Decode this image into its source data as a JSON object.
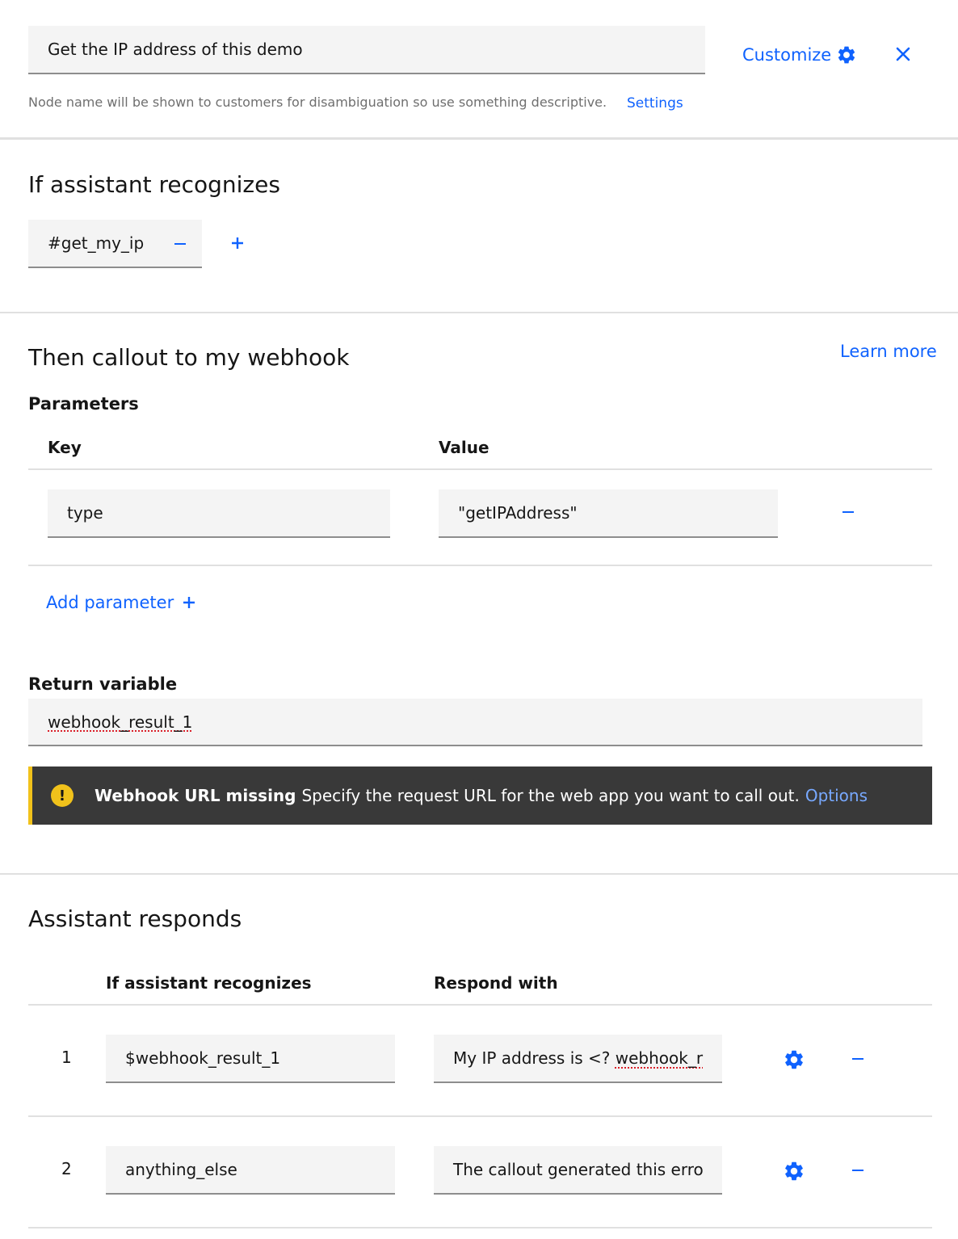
{
  "header": {
    "node_name": "Get the IP address of this demo",
    "customize_label": "Customize",
    "hint": "Node name will be shown to customers for disambiguation so use something descriptive.",
    "settings_label": "Settings"
  },
  "recognizes": {
    "title": "If assistant recognizes",
    "condition": "#get_my_ip"
  },
  "webhook": {
    "title": "Then callout to my webhook",
    "learn_more": "Learn more",
    "params_title": "Parameters",
    "key_header": "Key",
    "value_header": "Value",
    "params": [
      {
        "key": "type",
        "value": "\"getIPAddress\""
      }
    ],
    "add_param_label": "Add parameter",
    "return_title": "Return variable",
    "return_value": "webhook_result_1",
    "notification": {
      "title": "Webhook URL missing",
      "message": "Specify the request URL for the web app you want to call out.",
      "action": "Options"
    }
  },
  "responds": {
    "title": "Assistant responds",
    "condition_header": "If assistant recognizes",
    "response_header": "Respond with",
    "rows": [
      {
        "index": "1",
        "condition": "$webhook_result_1",
        "response_prefix": "My IP address is <? ",
        "response_suffix": "webhook_r"
      },
      {
        "index": "2",
        "condition": "anything_else",
        "response_prefix": "The callout generated this erro",
        "response_suffix": ""
      }
    ]
  },
  "colors": {
    "accent": "#0f62fe",
    "warning": "#f1c21b",
    "notification_bg": "#393939",
    "field_bg": "#f4f4f4"
  }
}
